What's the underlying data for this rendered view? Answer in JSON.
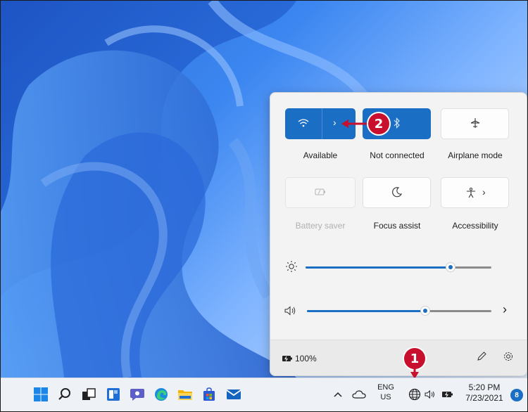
{
  "quick_settings": {
    "tiles": [
      {
        "label": "Available",
        "icon": "wifi-icon",
        "state": "on",
        "has_chevron": true
      },
      {
        "label": "Not connected",
        "icon": "bluetooth-icon",
        "state": "on"
      },
      {
        "label": "Airplane mode",
        "icon": "airplane-icon",
        "state": "off"
      },
      {
        "label": "Battery saver",
        "icon": "battery-saver-icon",
        "state": "disabled"
      },
      {
        "label": "Focus assist",
        "icon": "moon-icon",
        "state": "off"
      },
      {
        "label": "Accessibility",
        "icon": "accessibility-icon",
        "state": "off",
        "has_chevron": true
      }
    ],
    "brightness_level": 0.78,
    "volume_level": 0.64,
    "battery_text": "100%"
  },
  "callouts": {
    "one": "1",
    "two": "2"
  },
  "taskbar": {
    "input_lang": "ENG",
    "input_region": "US",
    "time": "5:20 PM",
    "date": "7/23/2021",
    "notification_count": "8"
  },
  "colors": {
    "accent": "#1a6fc4",
    "callout": "#c8102e"
  }
}
